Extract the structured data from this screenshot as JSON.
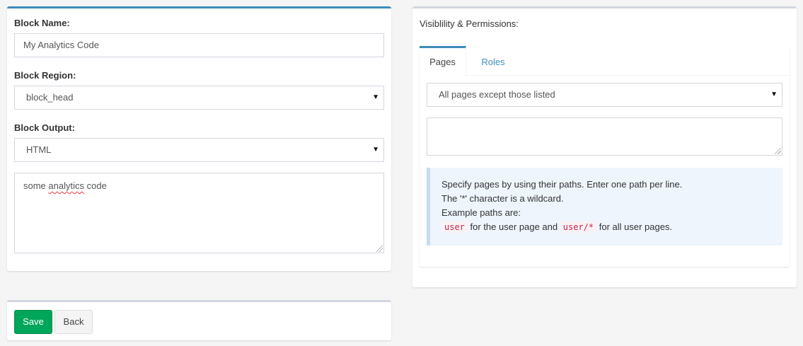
{
  "block_form": {
    "name_label": "Block Name:",
    "name_value": "My Analytics Code",
    "region_label": "Block Region:",
    "region_value": "block_head",
    "output_label": "Block Output:",
    "output_value": "HTML",
    "content_word1": "some",
    "content_word2": "analytics",
    "content_word3": "code"
  },
  "visibility": {
    "title": "Visiblility & Permissions:",
    "tabs": [
      {
        "label": "Pages",
        "active": true
      },
      {
        "label": "Roles",
        "active": false
      }
    ],
    "pages_mode": "All pages except those listed",
    "pages_list": "",
    "help": {
      "line1": "Specify pages by using their paths. Enter one path per line.",
      "line2": "The '*' character is a wildcard.",
      "line3": "Example paths are:",
      "code1": "user",
      "mid": "for the user page and",
      "code2": "user/*",
      "end": "for all user pages."
    }
  },
  "actions": {
    "save_label": "Save",
    "back_label": "Back"
  },
  "colors": {
    "accent": "#3c8dbc",
    "save_green": "#00a65a",
    "callout_bg": "#eef5fc"
  },
  "icons": [
    "caret-down-icon",
    "resize-handle-icon"
  ]
}
